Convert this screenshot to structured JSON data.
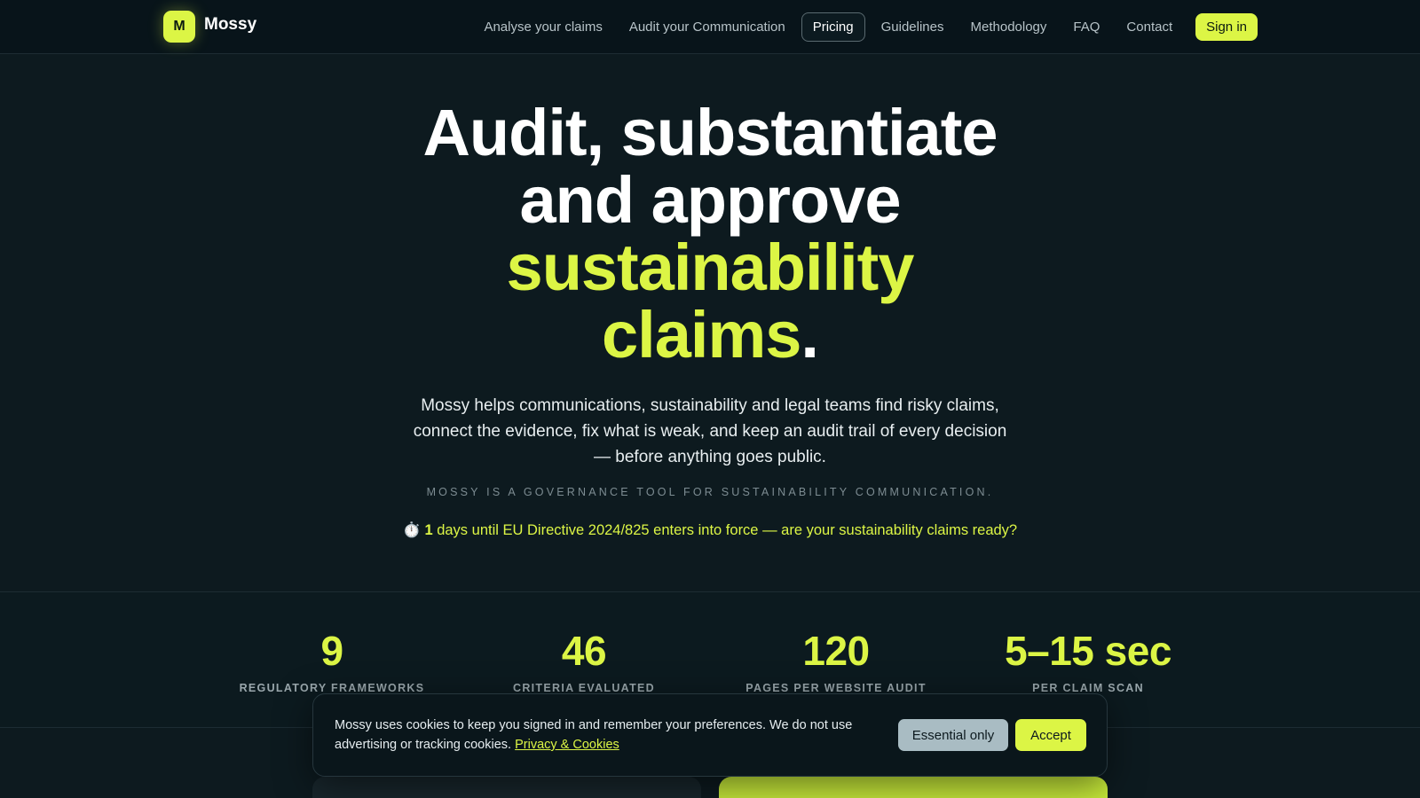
{
  "brand": {
    "logo_letter": "M",
    "name": "Mossy"
  },
  "nav": {
    "links": [
      {
        "label": "Analyse your claims"
      },
      {
        "label": "Audit your Communication"
      },
      {
        "label": "Pricing",
        "active": true
      },
      {
        "label": "Guidelines"
      },
      {
        "label": "Methodology"
      },
      {
        "label": "FAQ"
      },
      {
        "label": "Contact"
      }
    ],
    "signin_label": "Sign in"
  },
  "hero": {
    "title_line1": "Audit, substantiate",
    "title_line2": "and approve",
    "title_accent_line3": "sustainability",
    "title_accent_line4": "claims",
    "title_period": ".",
    "subtitle": "Mossy helps communications, sustainability and legal teams find risky claims, connect the evidence, fix what is weak, and keep an audit trail of every decision — before anything goes public.",
    "tagline": "Mossy is a governance tool for sustainability communication.",
    "countdown_icon": "⏱️",
    "countdown_number": "1",
    "countdown_text": " days until EU Directive 2024/825 enters into force — are your sustainability claims ready?"
  },
  "stats": [
    {
      "value": "9",
      "label": "Regulatory frameworks"
    },
    {
      "value": "46",
      "label": "Criteria evaluated"
    },
    {
      "value": "120",
      "label": "Pages per website audit"
    },
    {
      "value": "5–15 sec",
      "label": "Per claim scan"
    }
  ],
  "cookie": {
    "text": "Mossy uses cookies to keep you signed in and remember your preferences. We do not use advertising or tracking cookies.",
    "link_label": "Privacy & Cookies",
    "essential_label": "Essential only",
    "accept_label": "Accept"
  },
  "colors": {
    "accent": "#dcf545",
    "background": "#0d1a1f",
    "nav_background": "#08141a"
  }
}
